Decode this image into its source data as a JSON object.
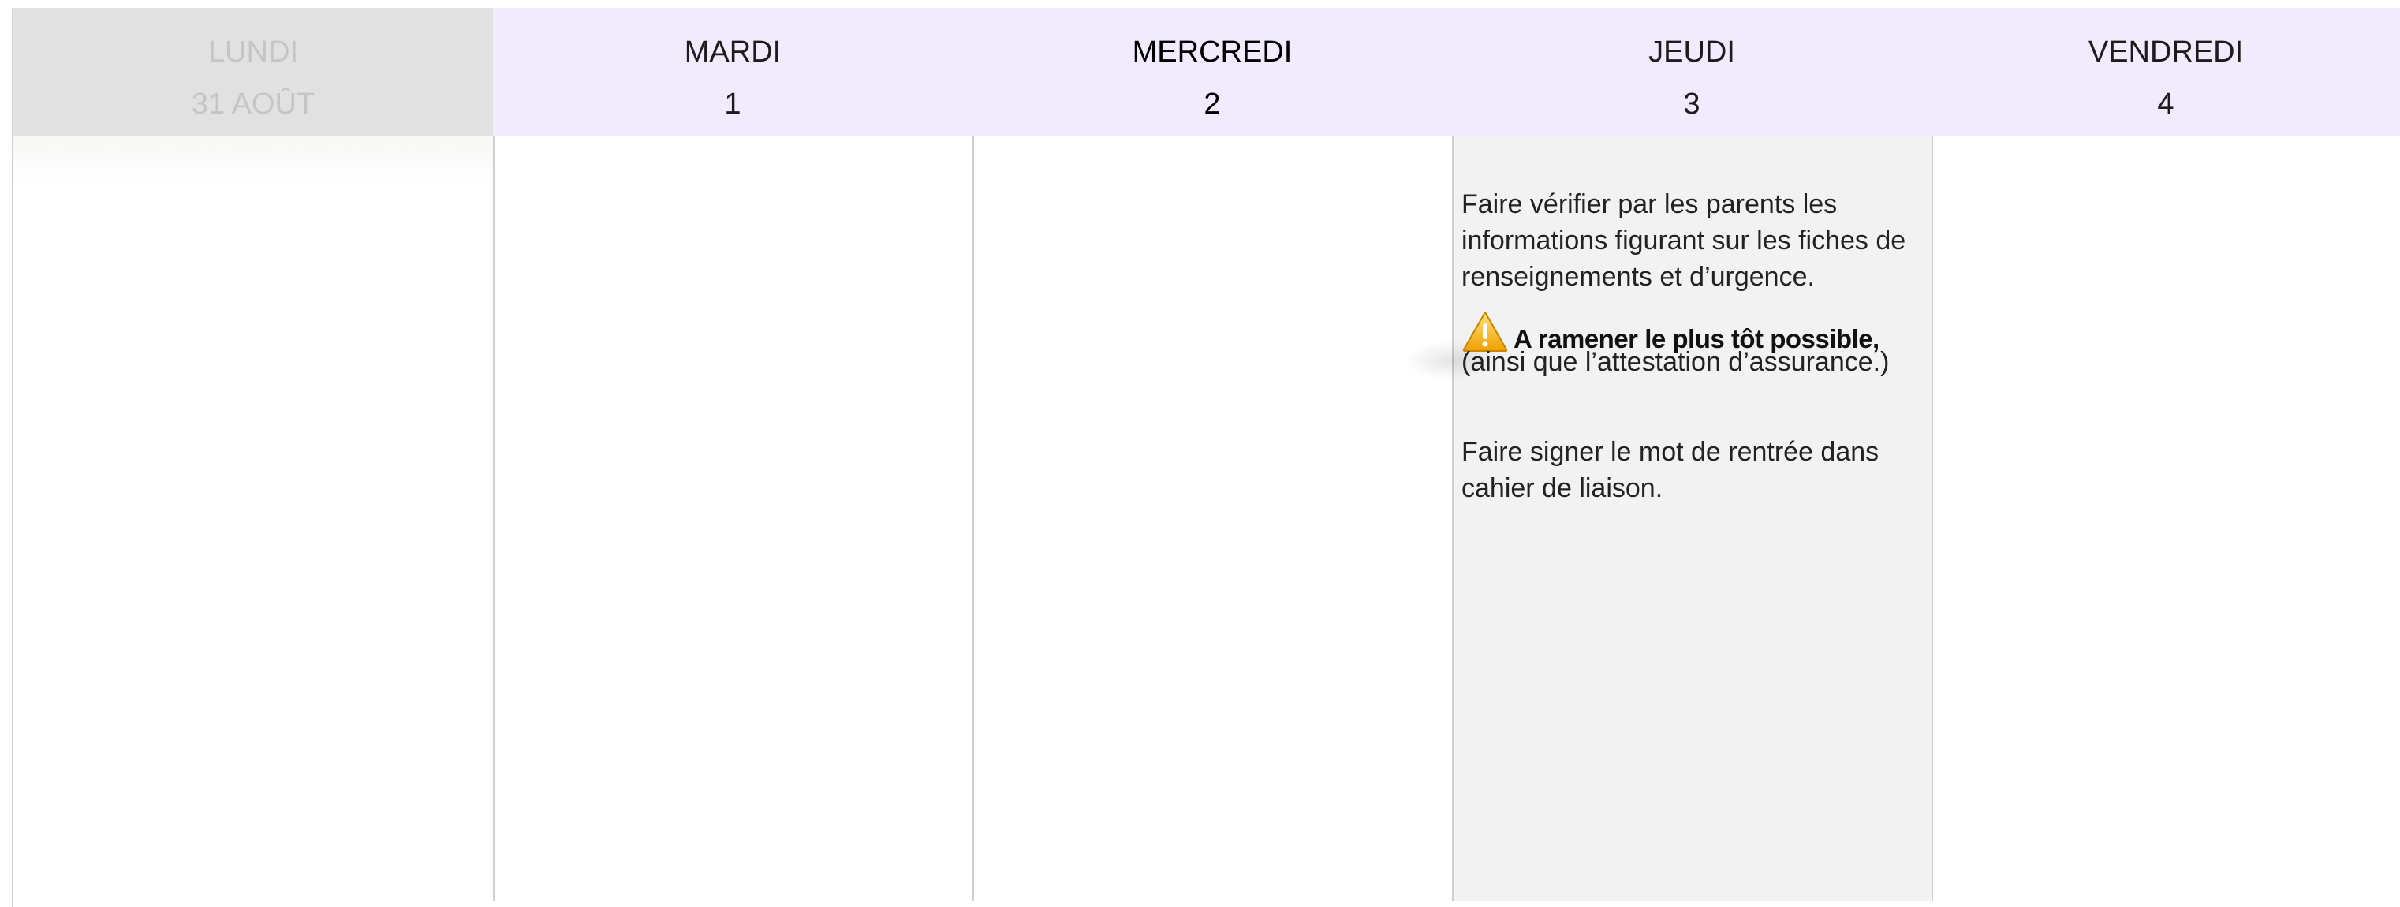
{
  "days": [
    {
      "name": "LUNDI",
      "date": "31 AOÛT",
      "state": "past"
    },
    {
      "name": "MARDI",
      "date": "1"
    },
    {
      "name": "MERCREDI",
      "date": "2"
    },
    {
      "name": "JEUDI",
      "date": "3"
    },
    {
      "name": "VENDREDI",
      "date": "4"
    }
  ],
  "jeudi_note": {
    "p1": "Faire vérifier par les parents les informations figurant sur les fiches de renseignements et d’urgence.",
    "warning_icon": "warning-triangle-icon",
    "warning_text": "A ramener le plus tôt possible,",
    "p2": "(ainsi que l’attestation d’assurance.)",
    "p3": "Faire signer le mot de rentrée dans cahier de liaison."
  },
  "colors": {
    "past_header": "#e0e1e0",
    "week_header": "#f1ebfd",
    "highlight_body": "#f2f2f2",
    "warning": "#f5b301"
  }
}
